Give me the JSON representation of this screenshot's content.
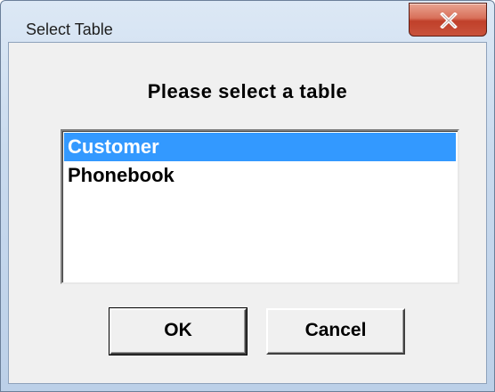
{
  "window": {
    "title": "Select Table"
  },
  "dialog": {
    "heading": "Please select a table",
    "list": {
      "items": [
        {
          "label": "Customer",
          "selected": true
        },
        {
          "label": "Phonebook",
          "selected": false
        }
      ]
    },
    "buttons": {
      "ok_label": "OK",
      "cancel_label": "Cancel"
    }
  },
  "icons": {
    "close": "close-icon"
  },
  "colors": {
    "selection": "#3399ff",
    "close_button": "#c9533c",
    "dialog_background": "#f0f0f0"
  }
}
